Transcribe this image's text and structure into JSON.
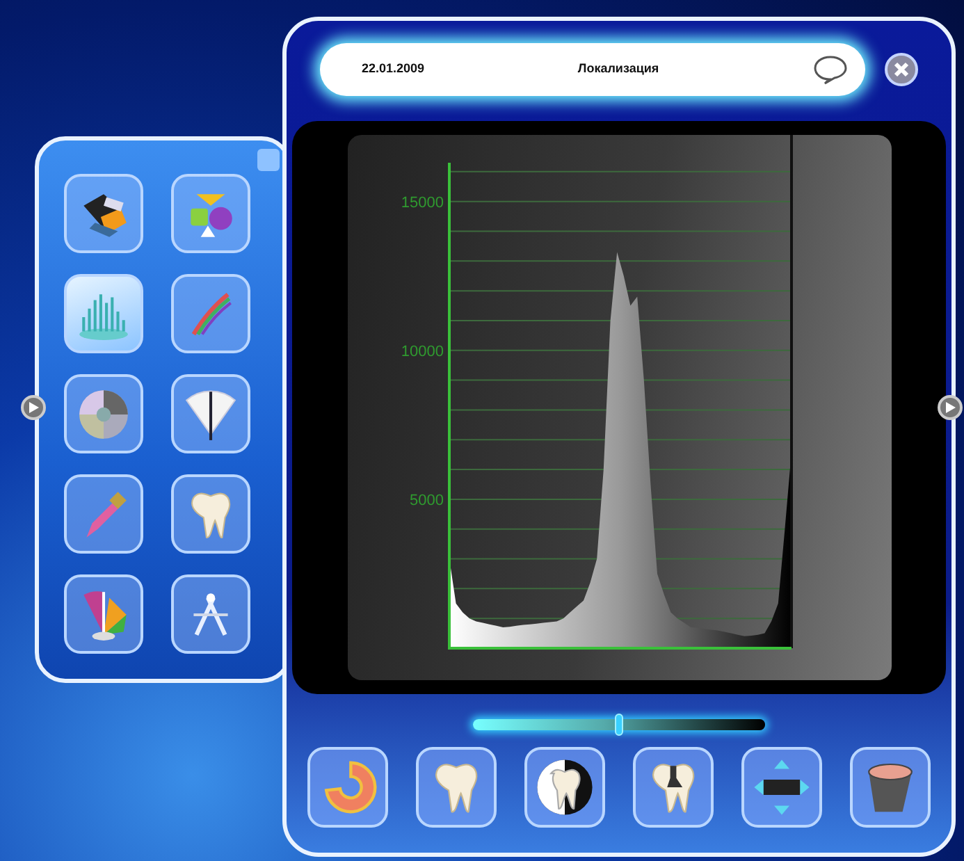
{
  "header": {
    "date": "22.01.2009",
    "title": "Локализация"
  },
  "left_tools": [
    {
      "kind": "paint",
      "selected": false
    },
    {
      "kind": "shapes",
      "selected": false
    },
    {
      "kind": "histogram",
      "selected": true
    },
    {
      "kind": "brush-stroke",
      "selected": false
    },
    {
      "kind": "color-wheel",
      "selected": false
    },
    {
      "kind": "fan",
      "selected": false
    },
    {
      "kind": "pipette",
      "selected": false
    },
    {
      "kind": "tooth",
      "selected": false
    },
    {
      "kind": "palette",
      "selected": false
    },
    {
      "kind": "compass",
      "selected": false
    }
  ],
  "histogram": {
    "chart_data": {
      "type": "area",
      "categories": [
        null,
        null,
        null,
        null,
        null,
        null,
        null,
        null,
        null,
        null,
        null,
        null,
        null,
        null,
        null,
        null,
        null,
        null,
        null,
        null,
        null,
        null,
        null,
        null,
        null,
        null,
        null,
        null,
        null,
        null,
        null,
        null,
        null,
        null,
        null,
        null,
        null,
        null,
        null,
        null,
        null,
        null,
        null,
        null,
        null,
        null,
        null,
        null,
        null,
        null,
        null,
        null
      ],
      "series": [
        {
          "color": "#ffffff",
          "values": [
            3000,
            1500,
            1200,
            1000,
            900,
            850,
            800,
            750,
            700,
            720,
            750,
            780,
            800,
            820,
            850,
            880,
            900,
            1000,
            1200,
            1400,
            1600,
            2200,
            3000,
            6000,
            11000,
            13300,
            12500,
            11500,
            11800,
            9000,
            5500,
            2500,
            1800,
            1200,
            1000,
            850,
            700,
            680,
            650,
            620,
            600,
            550,
            500,
            450,
            400,
            420,
            450,
            500,
            900,
            1500,
            4000,
            6600
          ]
        }
      ],
      "ylim": [
        0,
        16300
      ],
      "grid": true,
      "yticks": [
        5000,
        10000,
        15000
      ]
    }
  },
  "slider": {
    "level": 0.5
  },
  "bottom_tools": [
    {
      "kind": "ring"
    },
    {
      "kind": "tooth"
    },
    {
      "kind": "tooth-contrast"
    },
    {
      "kind": "tooth-filling"
    },
    {
      "kind": "resize"
    },
    {
      "kind": "cup"
    }
  ]
}
